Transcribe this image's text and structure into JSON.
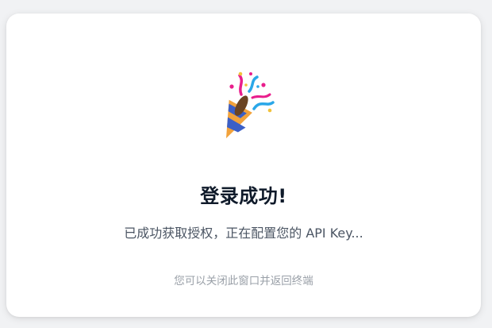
{
  "success": {
    "icon": "party-popper-icon",
    "title": "登录成功!",
    "message": "已成功获取授权，正在配置您的 API Key...",
    "hint": "您可以关闭此窗口并返回终端"
  },
  "colors": {
    "background": "#f1f2f4",
    "card": "#ffffff",
    "title": "#0f1a2a",
    "message": "#4b5563",
    "hint": "#9aa0a8"
  }
}
